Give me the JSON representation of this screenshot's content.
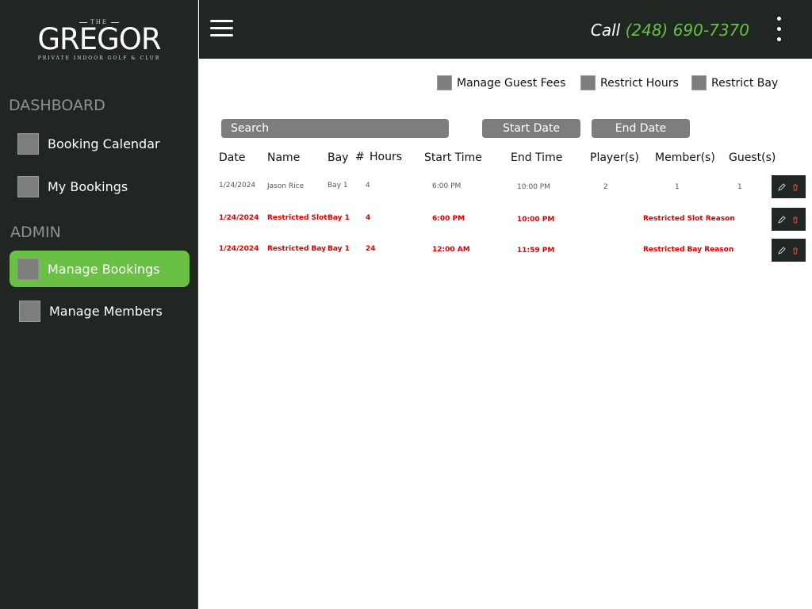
{
  "brand": {
    "the": "THE",
    "name": "GREGOR",
    "tagline": "PRIVATE INDOOR GOLF & CLUB"
  },
  "sidebar": {
    "dashboard_title": "DASHBOARD",
    "dashboard_items": [
      {
        "label": "Booking Calendar"
      },
      {
        "label": "My Bookings"
      }
    ],
    "admin_title": "ADMIN",
    "admin_items": [
      {
        "label": "Manage Bookings",
        "active": true
      },
      {
        "label": "Manage Members",
        "active": false
      }
    ]
  },
  "topbar": {
    "call_label": "Call",
    "phone": "(248) 690-7370",
    "menu_icon": "hamburger-icon",
    "more_icon": "kebab-menu-icon"
  },
  "filters": {
    "checkboxes": [
      {
        "label": "Manage Guest Fees"
      },
      {
        "label": "Restrict Hours"
      },
      {
        "label": "Restrict Bay"
      }
    ],
    "search_placeholder": "Search",
    "start_date_label": "Start Date",
    "end_date_label": "End Date"
  },
  "table": {
    "headers": [
      "Date",
      "Name",
      "Bay",
      "#",
      "Hours",
      "Start Time",
      "End Time",
      "Player(s)",
      "Member(s)",
      "Guest(s)"
    ],
    "rows": [
      {
        "date": "1/24/2024",
        "name": "Jason Rice",
        "bay": "Bay 1",
        "hours": "4",
        "start": "6:00 PM",
        "end": "10:00 PM",
        "players": "2",
        "members": "1",
        "guests": "1",
        "reason": ""
      },
      {
        "date": "1/24/2024",
        "name": "Restricted Slot",
        "bay": "Bay 1",
        "hours": "4",
        "start": "6:00 PM",
        "end": "10:00 PM",
        "players": "",
        "members": "",
        "guests": "",
        "reason": "Restricted Slot Reason"
      },
      {
        "date": "1/24/2024",
        "name": "Restricted Bay",
        "bay": "Bay 1",
        "hours": "24",
        "start": "12:00 AM",
        "end": "11:59 PM",
        "players": "",
        "members": "",
        "guests": "",
        "reason": "Restricted Bay Reason"
      }
    ]
  },
  "colors": {
    "sidebar_bg": "#202622",
    "accent_green": "#6abf45",
    "restricted_red": "#e00000",
    "control_gray": "#7b7e7b"
  }
}
